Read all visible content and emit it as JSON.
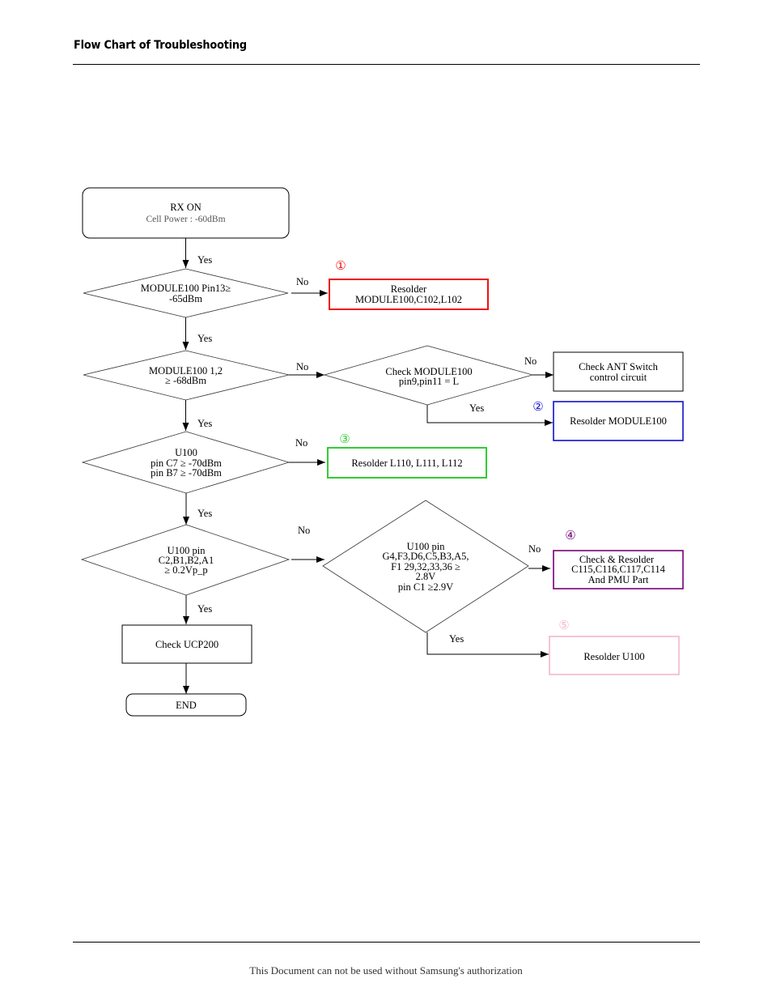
{
  "header": {
    "title": "Flow Chart of Troubleshooting"
  },
  "footer": {
    "text": "This Document can not be used without Samsung's authorization"
  },
  "colors": {
    "step1": "#ee1111",
    "step2": "#1111cc",
    "step3": "#33cc33",
    "step4": "#770077",
    "step5": "#f4b8c8"
  },
  "flowchart": {
    "start": {
      "title": "RX ON",
      "subtitle": "Cell Power : -60dBm"
    },
    "decision1": {
      "lines": [
        "MODULE100 Pin13≥",
        "-65dBm"
      ]
    },
    "decision2": {
      "lines": [
        "MODULE100 1,2",
        "≥ -68dBm"
      ]
    },
    "decision2b": {
      "lines": [
        "Check MODULE100",
        "pin9,pin11 = L"
      ]
    },
    "decision3": {
      "lines": [
        "U100",
        "pin C7 ≥ -70dBm",
        "pin B7 ≥ -70dBm"
      ]
    },
    "decision4": {
      "lines": [
        "U100 pin",
        "C2,B1,B2,A1",
        "≥ 0.2Vp_p"
      ]
    },
    "decision4b": {
      "lines": [
        "U100 pin",
        "G4,F3,D6,C5,B3,A5,",
        "F1 29,32,33,36 ≥",
        "2.8V",
        "pin C1 ≥2.9V"
      ]
    },
    "action1": {
      "marker": "①",
      "lines": [
        "Resolder",
        "MODULE100,C102,L102"
      ]
    },
    "action_ant": {
      "lines": [
        "Check ANT Switch",
        "control circuit"
      ]
    },
    "action2": {
      "marker": "②",
      "lines": [
        "Resolder MODULE100"
      ]
    },
    "action3": {
      "marker": "③",
      "lines": [
        "Resolder L110, L111, L112"
      ]
    },
    "action4": {
      "marker": "④",
      "lines": [
        "Check & Resolder",
        "C115,C116,C117,C114",
        "And PMU Part"
      ]
    },
    "action5": {
      "marker": "⑤",
      "lines": [
        "Resolder U100"
      ]
    },
    "check_ucp": {
      "lines": [
        "Check UCP200"
      ]
    },
    "end": {
      "label": "END"
    },
    "labels": {
      "yes": "Yes",
      "no": "No"
    }
  }
}
